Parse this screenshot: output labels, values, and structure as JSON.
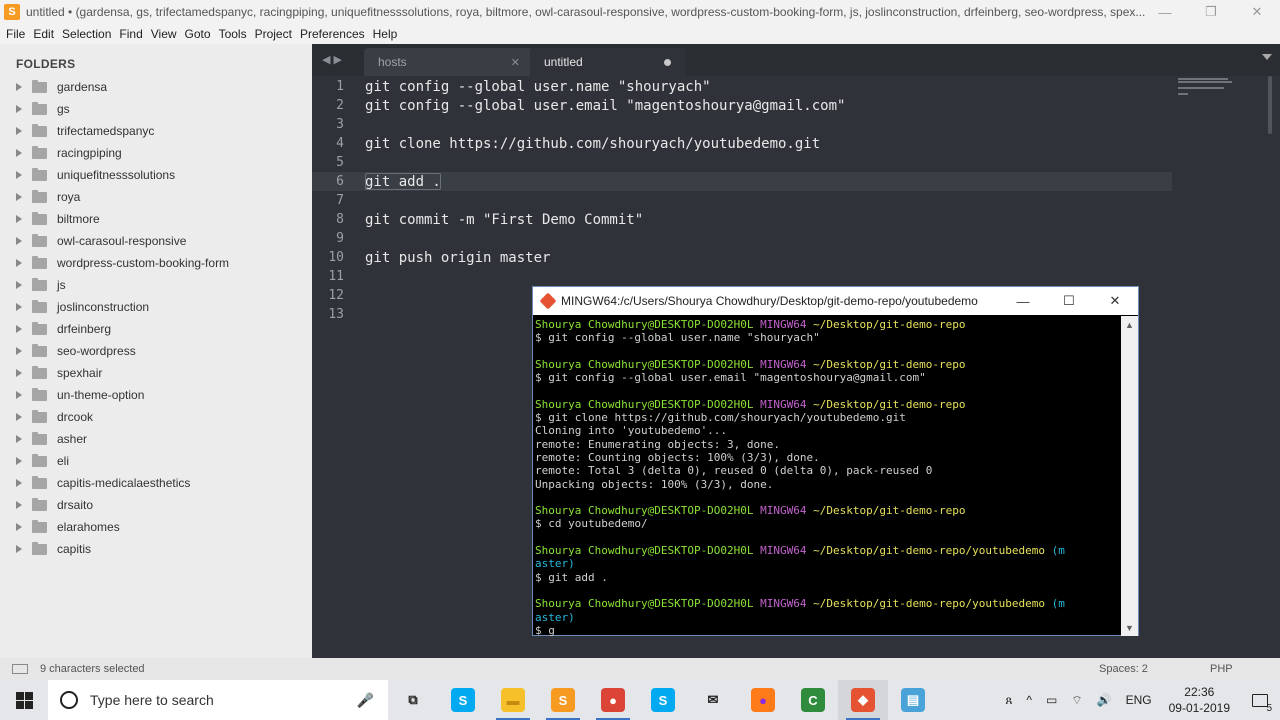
{
  "window": {
    "title": "untitled • (gardensa, gs, trifectamedspanyc, racingpiping, uniquefitnesssolutions, roya, biltmore, owl-carasoul-responsive, wordpress-custom-booking-form, js, joslinconstruction, drfeinberg, seo-wordpress, spex...",
    "app_icon_letter": "S",
    "minimize": "—",
    "maximize": "❐",
    "close": "✕"
  },
  "menu": [
    "File",
    "Edit",
    "Selection",
    "Find",
    "View",
    "Goto",
    "Tools",
    "Project",
    "Preferences",
    "Help"
  ],
  "sidebar": {
    "title": "FOLDERS",
    "folders": [
      "gardensa",
      "gs",
      "trifectamedspanyc",
      "racingpiping",
      "uniquefitnesssolutions",
      "roya",
      "biltmore",
      "owl-carasoul-responsive",
      "wordpress-custom-booking-form",
      "js",
      "joslinconstruction",
      "drfeinberg",
      "seo-wordpress",
      "spexhair",
      "un-theme-option",
      "drcook",
      "asher",
      "eli",
      "capitis-medicalaesthetics",
      "drsaito",
      "elarahomes",
      "capitis"
    ]
  },
  "tabs": {
    "nav": "◀ ▶",
    "items": [
      {
        "label": "hosts",
        "close": "✕"
      },
      {
        "label": "untitled"
      }
    ]
  },
  "editor": {
    "current_line": 6,
    "lines": [
      "git config --global user.name \"shouryach\"",
      "git config --global user.email \"magentoshourya@gmail.com\"",
      "",
      "git clone https://github.com/shouryach/youtubedemo.git",
      "",
      "git add .",
      "",
      "git commit -m \"First Demo Commit\"",
      "",
      "git push origin master",
      "",
      "",
      ""
    ]
  },
  "status": {
    "selection": "9 characters selected",
    "spaces": "Spaces: 2",
    "syntax": "PHP"
  },
  "terminal": {
    "title": "MINGW64:/c/Users/Shourya Chowdhury/Desktop/git-demo-repo/youtubedemo",
    "minimize": "—",
    "maximize": "☐",
    "close": "✕",
    "user": "Shourya Chowdhury@DESKTOP-DO02H0L",
    "env": "MINGW64",
    "path_repo": "~/Desktop/git-demo-repo",
    "path_sub": "~/Desktop/git-demo-repo/youtubedemo",
    "branch_a": "(m",
    "branch_b": "aster)",
    "cmd1": "$ git config --global user.name \"shouryach\"",
    "cmd2": "$ git config --global user.email \"magentoshourya@gmail.com\"",
    "cmd3": "$ git clone https://github.com/shouryach/youtubedemo.git",
    "out1": "Cloning into 'youtubedemo'...",
    "out2": "remote: Enumerating objects: 3, done.",
    "out3": "remote: Counting objects: 100% (3/3), done.",
    "out4": "remote: Total 3 (delta 0), reused 0 (delta 0), pack-reused 0",
    "out5": "Unpacking objects: 100% (3/3), done.",
    "cmd4": "$ cd youtubedemo/",
    "cmd5": "$ git add .",
    "cmd6": "$ g",
    "scroll_up": "▲",
    "scroll_down": "▼"
  },
  "taskbar": {
    "search_placeholder": "Type here to search",
    "mic": "🎤",
    "apps": [
      {
        "name": "task-view",
        "glyph": "⧉",
        "color": "#e5e6e9",
        "fg": "#222"
      },
      {
        "name": "skype",
        "glyph": "S",
        "color": "#00a9f0",
        "fg": "#fff"
      },
      {
        "name": "file-explorer",
        "glyph": "▬",
        "color": "#f5c02a",
        "fg": "#c78a10"
      },
      {
        "name": "sublime-text",
        "glyph": "S",
        "color": "#f79a22",
        "fg": "#fff"
      },
      {
        "name": "chrome",
        "glyph": "●",
        "color": "#db4437",
        "fg": "#fff"
      },
      {
        "name": "skype-business",
        "glyph": "S",
        "color": "#00a9f0",
        "fg": "#fff"
      },
      {
        "name": "mail",
        "glyph": "✉",
        "color": "#e5e6e9",
        "fg": "#222"
      },
      {
        "name": "firefox",
        "glyph": "●",
        "color": "#ff7a18",
        "fg": "#8a2be2"
      },
      {
        "name": "camtasia",
        "glyph": "C",
        "color": "#2f8c3c",
        "fg": "#fff"
      },
      {
        "name": "git-bash",
        "glyph": "◆",
        "color": "#e55332",
        "fg": "#fff"
      },
      {
        "name": "notepad",
        "glyph": "▤",
        "color": "#4aa3d8",
        "fg": "#fff"
      }
    ],
    "tray": [
      "ጸ",
      "^",
      "▭",
      "⌔",
      "🔊",
      "ENG"
    ],
    "time": "22:36",
    "date": "09-01-2019",
    "notifications": "5"
  }
}
